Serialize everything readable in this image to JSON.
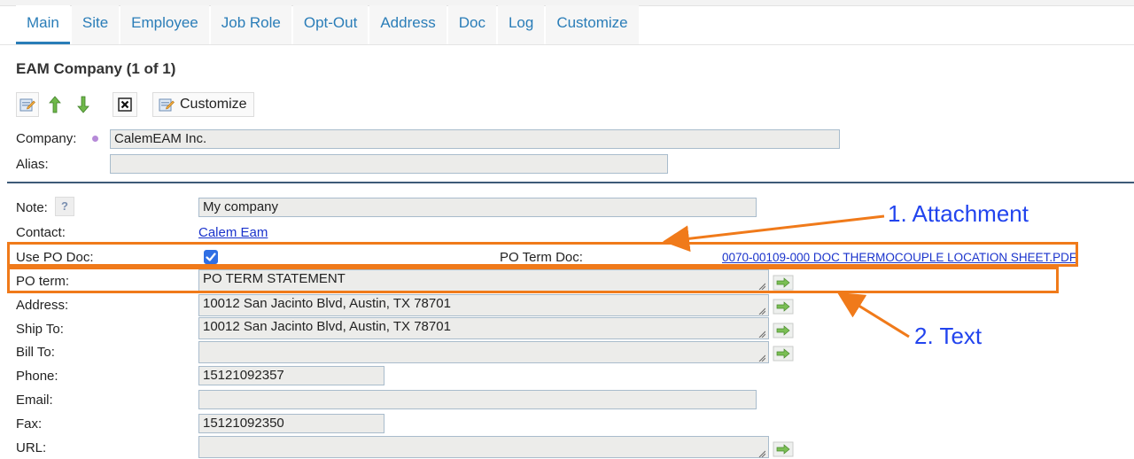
{
  "tabs": [
    {
      "label": "Main",
      "active": true
    },
    {
      "label": "Site"
    },
    {
      "label": "Employee"
    },
    {
      "label": "Job Role"
    },
    {
      "label": "Opt-Out"
    },
    {
      "label": "Address"
    },
    {
      "label": "Doc"
    },
    {
      "label": "Log"
    },
    {
      "label": "Customize"
    }
  ],
  "title": "EAM Company (1 of 1)",
  "toolbar": {
    "customize_label": "Customize",
    "icons": [
      "edit-icon",
      "arrow-up-icon",
      "arrow-down-icon",
      "delete-icon",
      "customize-icon"
    ]
  },
  "header_fields": {
    "company_label": "Company:",
    "company_value": "CalemEAM Inc.",
    "alias_label": "Alias:",
    "alias_value": ""
  },
  "fields": {
    "note_label": "Note:",
    "note_help": "?",
    "note_value": "My company",
    "contact_label": "Contact:",
    "contact_value": "Calem Eam",
    "use_po_doc_label": "Use PO Doc:",
    "use_po_doc_checked": true,
    "po_term_doc_label": "PO Term Doc:",
    "po_term_doc_value": "0070-00109-000 DOC THERMOCOUPLE LOCATION SHEET.PDF",
    "po_term_label": "PO term:",
    "po_term_value": "PO TERM STATEMENT",
    "address_label": "Address:",
    "address_value": "10012 San Jacinto Blvd, Austin, TX 78701",
    "ship_to_label": "Ship To:",
    "ship_to_value": "10012 San Jacinto Blvd, Austin, TX 78701",
    "bill_to_label": "Bill To:",
    "bill_to_value": "",
    "phone_label": "Phone:",
    "phone_value": "15121092357",
    "email_label": "Email:",
    "email_value": "",
    "fax_label": "Fax:",
    "fax_value": "15121092350",
    "url_label": "URL:",
    "url_value": ""
  },
  "annotations": {
    "attachment": "1. Attachment",
    "text": "2. Text",
    "color": "#f07a1a",
    "text_color": "#2244ee"
  },
  "colors": {
    "accent": "#2a7db8",
    "divider": "#3d5a78",
    "link": "#1a33cc"
  }
}
